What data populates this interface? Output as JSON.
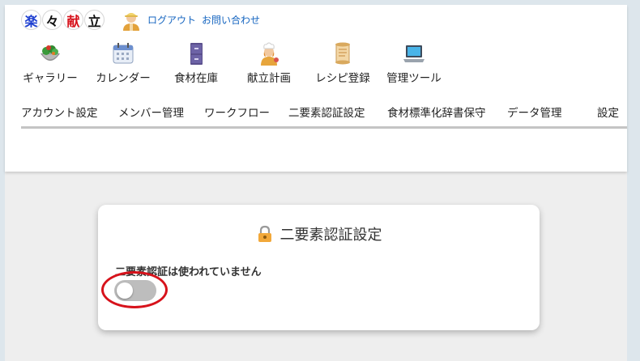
{
  "logo": {
    "chars": [
      "楽",
      "々",
      "献",
      "立"
    ],
    "colors": [
      "#1e3fd0",
      "#111111",
      "#d7121b",
      "#111111"
    ]
  },
  "header": {
    "user_icon": "user-avatar-icon",
    "links": {
      "logout": "ログアウト",
      "contact": "お問い合わせ"
    }
  },
  "main_nav": [
    {
      "label": "ギャラリー",
      "icon": "salad-bowl-icon"
    },
    {
      "label": "カレンダー",
      "icon": "calendar-icon"
    },
    {
      "label": "食材在庫",
      "icon": "cabinet-icon"
    },
    {
      "label": "献立計画",
      "icon": "chef-icon"
    },
    {
      "label": "レシピ登録",
      "icon": "scroll-icon"
    },
    {
      "label": "管理ツール",
      "icon": "laptop-icon"
    }
  ],
  "sub_nav": [
    {
      "label": "アカウント設定"
    },
    {
      "label": "メンバー管理"
    },
    {
      "label": "ワークフロー"
    },
    {
      "label": "二要素認証設定"
    },
    {
      "label": "食材標準化辞書保守"
    },
    {
      "label": "データ管理"
    },
    {
      "label": "設定"
    }
  ],
  "card": {
    "title": "二要素認証設定",
    "title_icon": "lock-icon",
    "status": "二要素認証は使われていません",
    "toggle_on": false,
    "highlight_color": "#d7121b"
  }
}
